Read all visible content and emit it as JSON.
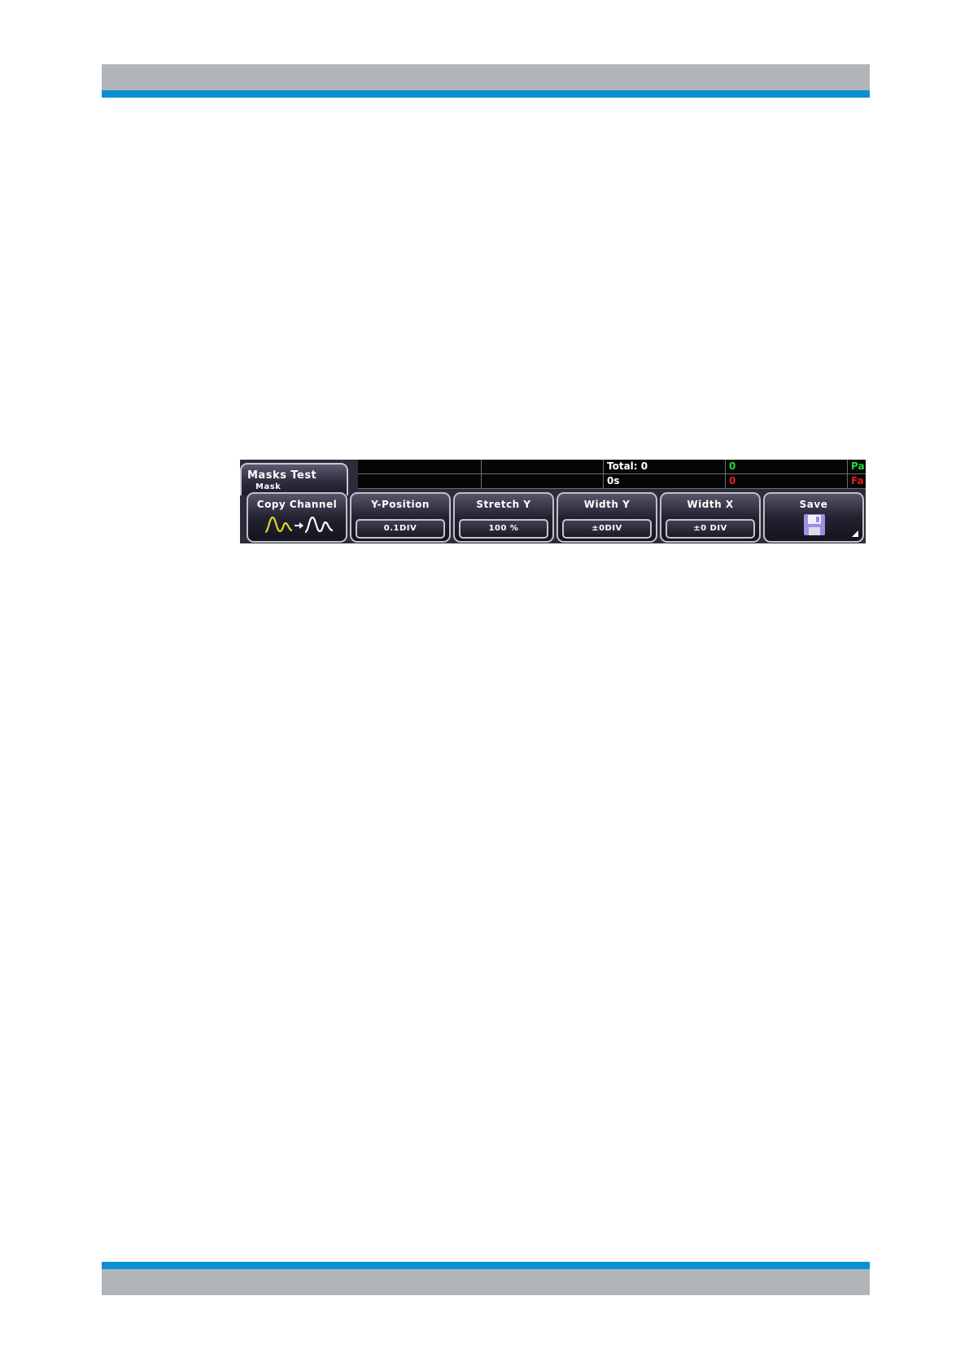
{
  "colors": {
    "header_gray": "#b1b5ba",
    "accent_blue": "#0b8fd6",
    "panel_bg": "#2d2c3a",
    "pass_green": "#27d83a",
    "fail_red": "#ea1d1d"
  },
  "menu": {
    "title": "Masks Test",
    "subtitle": "Mask"
  },
  "status": {
    "total_label": "Total:  0",
    "time_label": "0s",
    "pass_count": "0",
    "fail_count": "0",
    "pass_label": "Pa",
    "fail_label": "Fa"
  },
  "softkeys": [
    {
      "label": "Copy Channel",
      "icon": "copy-channel-waveform-icon"
    },
    {
      "label": "Y-Position",
      "value": "0.1DIV"
    },
    {
      "label": "Stretch Y",
      "value": "100 %"
    },
    {
      "label": "Width Y",
      "value": "±0DIV"
    },
    {
      "label": "Width X",
      "value": "±0 DIV"
    },
    {
      "label": "Save",
      "icon": "floppy-disk-icon"
    }
  ]
}
